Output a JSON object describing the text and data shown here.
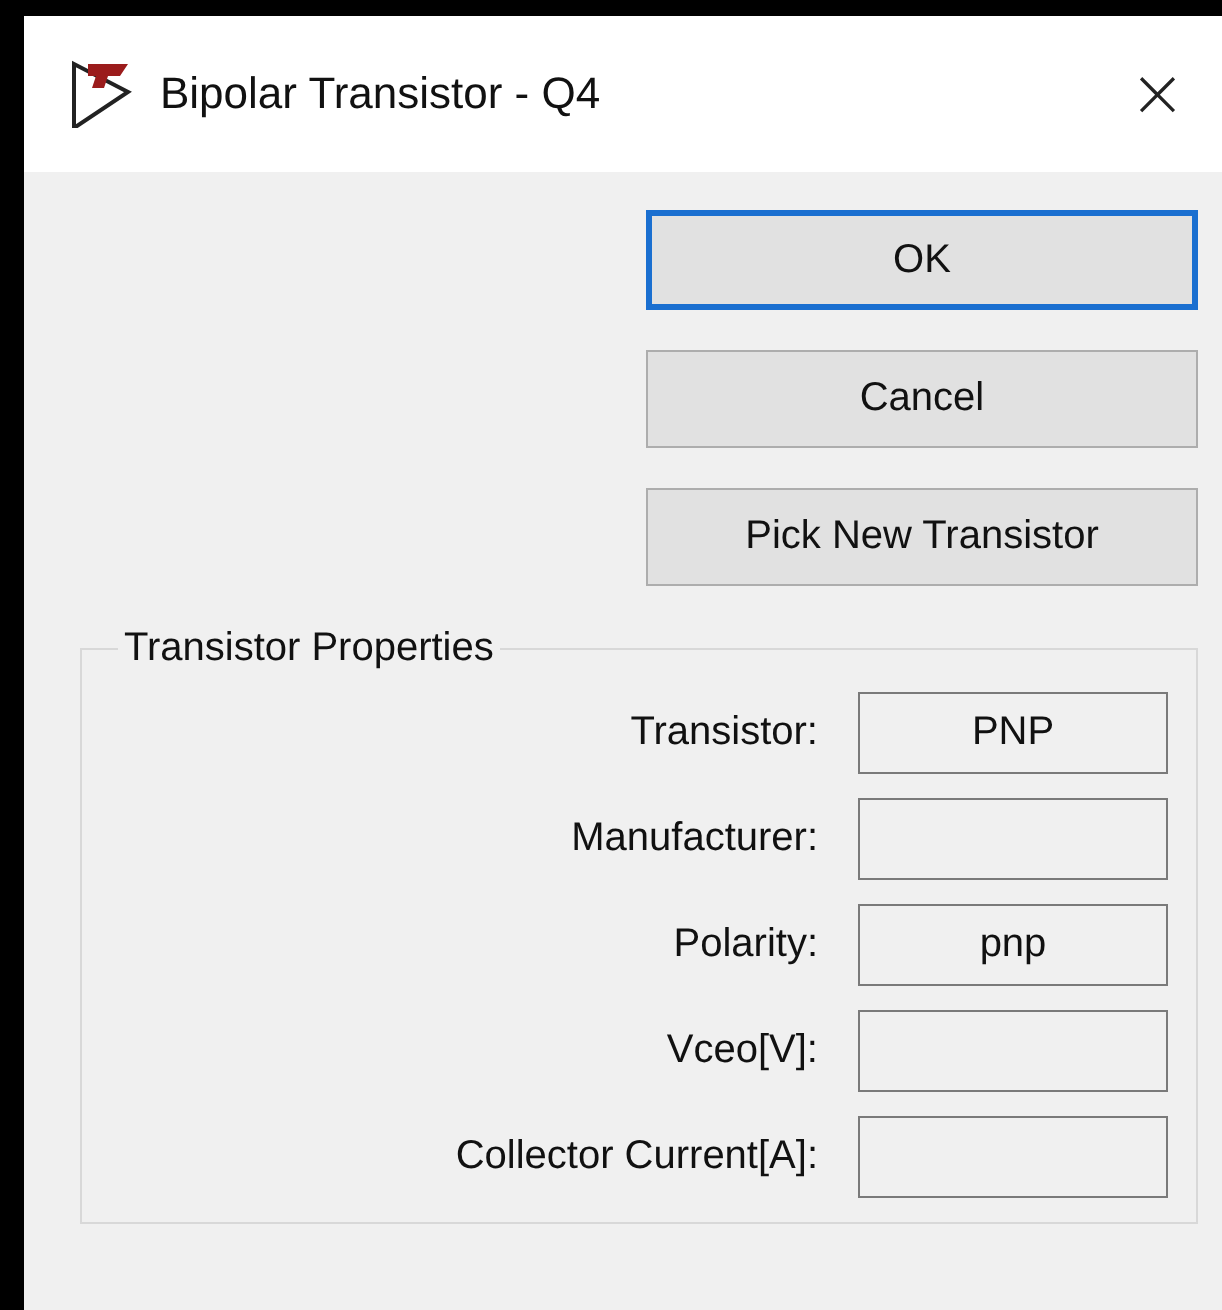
{
  "window": {
    "title": "Bipolar Transistor - Q4",
    "close": "×"
  },
  "buttons": [
    {
      "label": "OK",
      "default": true
    },
    {
      "label": "Cancel",
      "default": false
    },
    {
      "label": "Pick New Transistor",
      "default": false
    }
  ],
  "group": {
    "title": "Transistor Properties",
    "fields": [
      {
        "label": "Transistor:",
        "value": "PNP"
      },
      {
        "label": "Manufacturer:"
      },
      {
        "label": "Polarity:",
        "value": "pnp"
      },
      {
        "label": "Vceo[V]:"
      },
      {
        "label": "Collector Current[A]:"
      }
    ]
  }
}
